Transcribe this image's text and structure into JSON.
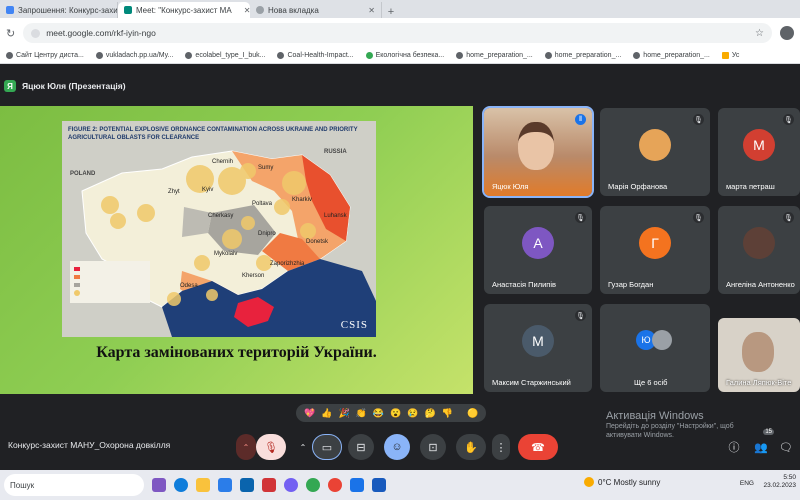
{
  "tabs": [
    {
      "label": "Запрошення: Конкурс-захист ",
      "active": false
    },
    {
      "label": "Meet: \"Конкурс-захист МА",
      "active": true
    },
    {
      "label": "Нова вкладка",
      "active": false
    }
  ],
  "new_tab_glyph": "+",
  "address": "meet.google.com/rkf-iyin-ngo",
  "bookmarks": [
    "Сайт Центру диста...",
    "vukladach.pp.ua/My...",
    "ecolabel_type_I_buk...",
    "Coal-Health-Impact...",
    "Екологічна безпека...",
    "home_preparation_...",
    "home_preparation_...",
    "home_preparation_...",
    "Ус"
  ],
  "presenter": {
    "badge": "Я",
    "label": "Яцюк Юля (Презентація)"
  },
  "slide": {
    "map_title": "FIGURE 2: POTENTIAL EXPLOSIVE ORDNANCE CONTAMINATION ACROSS UKRAINE AND PRIORITY AGRICULTURAL OBLASTS FOR CLEARANCE",
    "map_labels": {
      "russia": "RUSSIA",
      "poland": "POLAND",
      "kyiv": "Kyiv",
      "chernihiv": "Chernih",
      "sumy": "Sumy",
      "kharkiv": "Kharkiv",
      "zhytomyr": "Zhyt",
      "cherkasy": "Cherkasy",
      "poltava": "Poltava",
      "dnipro": "Dnipro",
      "luhansk": "Luhansk",
      "donetsk": "Donetsk",
      "zaporizhzhia": "Zaporizhzhia",
      "mykolaiv": "Mykolaiv",
      "kherson": "Kherson",
      "odesa": "Odesa"
    },
    "logo": "CSIS",
    "caption": "Карта замінованих територій України."
  },
  "participants": [
    {
      "name": "Яцюк Юля",
      "avatar": "",
      "color": "",
      "muted": false,
      "speaking": true,
      "video": true
    },
    {
      "name": "Марія Орфанова",
      "avatar": "",
      "color": "#e6a458",
      "muted": true,
      "speaking": false,
      "video": false
    },
    {
      "name": "марта петраш",
      "avatar": "М",
      "color": "#d23f31",
      "muted": true,
      "speaking": false,
      "video": false
    },
    {
      "name": "Анастасія Пилипів",
      "avatar": "А",
      "color": "#7e57c2",
      "muted": true,
      "speaking": false,
      "video": false
    },
    {
      "name": "Гузар Богдан",
      "avatar": "Г",
      "color": "#f4731f",
      "muted": true,
      "speaking": false,
      "video": false
    },
    {
      "name": "Ангеліна Антоненко",
      "avatar": "",
      "color": "#5d4037",
      "muted": true,
      "speaking": false,
      "video": false
    },
    {
      "name": "Максим Старжинський",
      "avatar": "М",
      "color": "#4a5a6a",
      "muted": true,
      "speaking": false,
      "video": false
    },
    {
      "name": "Ще 6 осіб",
      "avatar": "Ю",
      "color": "#1a73e8",
      "muted": false,
      "speaking": false,
      "video": false
    },
    {
      "name": "Галина Ляпюк-Віте",
      "avatar": "",
      "color": "#c8c0b4",
      "muted": false,
      "speaking": false,
      "video": true
    }
  ],
  "reactions": [
    "💖",
    "👍",
    "🎉",
    "👏",
    "😂",
    "😮",
    "😢",
    "🤔",
    "👎",
    "🟡"
  ],
  "meeting_name": "Конкурс-захист МАНУ_Охорона довкілля",
  "controls": {
    "hand_glyph": "✋",
    "more_glyph": "⋮",
    "participant_count": "15"
  },
  "windows_activation": {
    "title": "Активація Windows",
    "subtitle": "Перейдіть до розділу \"Настройки\", щоб активувати Windows."
  },
  "taskbar": {
    "search": "Пошук",
    "weather": "0°C Mostly sunny",
    "lang": "ENG",
    "time": "5:50",
    "date": "23.02.2023"
  },
  "colors": {
    "meet_bg": "#202124",
    "tile_bg": "#3c4043",
    "end_call": "#ea4335",
    "accent": "#8ab4f8"
  }
}
